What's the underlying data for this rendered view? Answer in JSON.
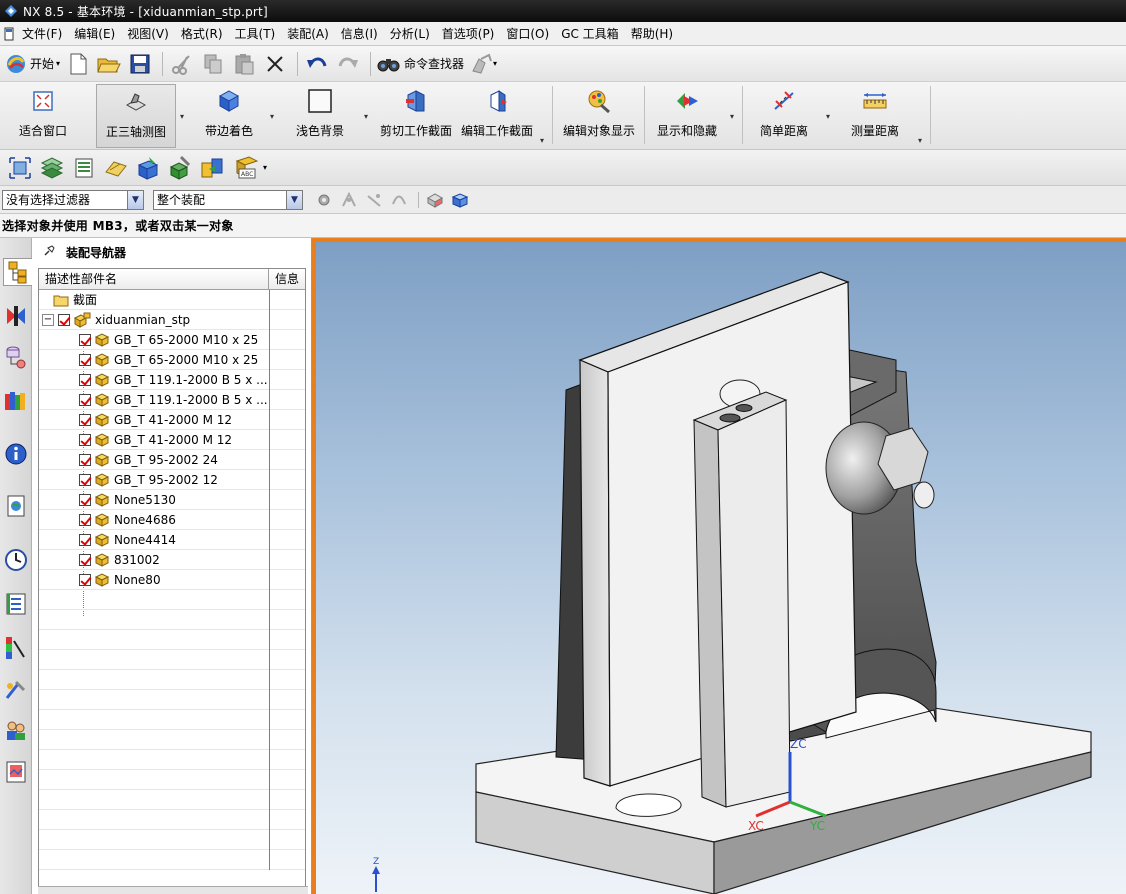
{
  "window": {
    "title": "NX 8.5 - 基本环境 - [xiduanmian_stp.prt]"
  },
  "menu": [
    "文件(F)",
    "编辑(E)",
    "视图(V)",
    "格式(R)",
    "工具(T)",
    "装配(A)",
    "信息(I)",
    "分析(L)",
    "首选项(P)",
    "窗口(O)",
    "GC 工具箱",
    "帮助(H)"
  ],
  "toolbar1": {
    "start_label": "开始",
    "command_finder_label": "命令查找器"
  },
  "toolbar2": {
    "fit": "适合窗口",
    "trimetric": "正三轴测图",
    "shaded_edges": "带边着色",
    "light_background": "浅色背景",
    "clip_section": "剪切工作截面",
    "edit_section": "编辑工作截面",
    "edit_display": "编辑对象显示",
    "show_hide": "显示和隐藏",
    "simple_distance": "简单距离",
    "measure_distance": "测量距离"
  },
  "selection": {
    "filter": "没有选择过滤器",
    "scope": "整个装配"
  },
  "status": "选择对象并使用 MB3，或者双击某一对象",
  "navigator": {
    "title": "装配导航器",
    "col_name": "描述性部件名",
    "col_info": "信息",
    "section_label": "截面",
    "root_label": "xiduanmian_stp",
    "parts": [
      "GB_T 65-2000 M10 x 25",
      "GB_T 65-2000 M10 x 25",
      "GB_T 119.1-2000 B 5 x ...",
      "GB_T 119.1-2000 B 5 x ...",
      "GB_T 41-2000 M 12",
      "GB_T 41-2000 M 12",
      "GB_T 95-2002 24",
      "GB_T 95-2002 12",
      "None5130",
      "None4686",
      "None4414",
      "831002",
      "None80"
    ]
  },
  "triad": {
    "zc": "ZC",
    "xc": "XC",
    "yc": "YC",
    "z": "Z"
  },
  "colors": {
    "viewport_border": "#e87f1f",
    "check_red": "#e00000",
    "part_yellow": "#f0b020"
  }
}
